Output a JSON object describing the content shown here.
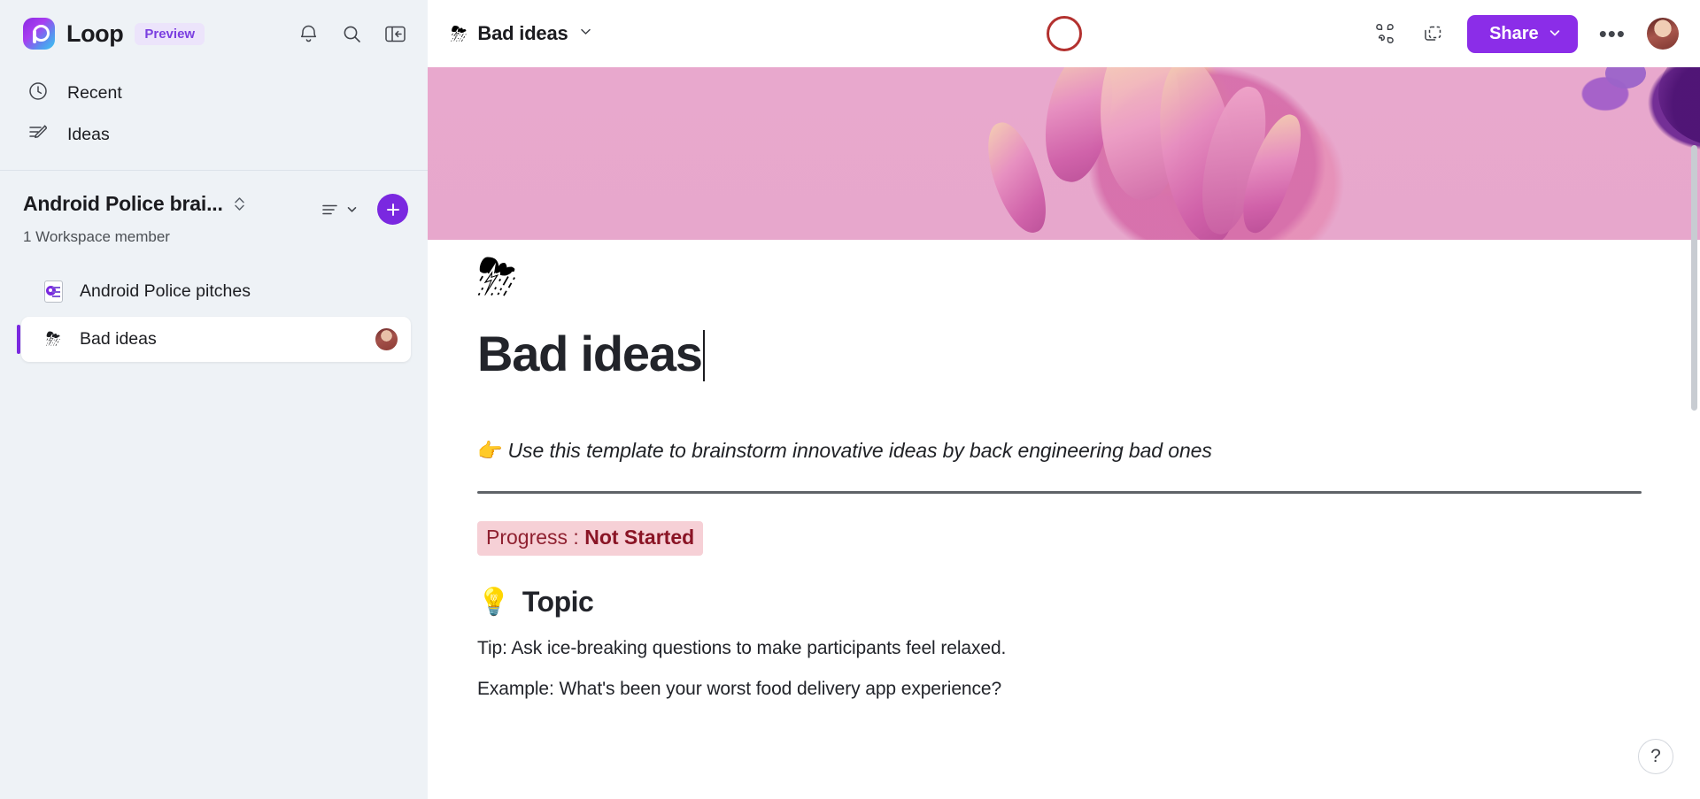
{
  "sidebar": {
    "brand": {
      "name": "Loop",
      "badge": "Preview",
      "logo_icon": "loop-logo"
    },
    "top_icons": [
      {
        "name": "notifications-icon",
        "label": "Notifications"
      },
      {
        "name": "search-icon",
        "label": "Search"
      },
      {
        "name": "collapse-panel-icon",
        "label": "Collapse navigation"
      }
    ],
    "nav": [
      {
        "label": "Recent",
        "icon": "clock-icon"
      },
      {
        "label": "Ideas",
        "icon": "pencil-lines-icon"
      }
    ],
    "workspace": {
      "title": "Android Police brai...",
      "members": "1 Workspace member",
      "switch_icon": "chevron-up-down-icon",
      "sort_icon": "sort-list-icon",
      "add_label": "+"
    },
    "pages": [
      {
        "label": "Android Police pitches",
        "icon": "loop-page-icon",
        "selected": false,
        "avatar": false
      },
      {
        "label": "Bad ideas",
        "icon": "cloud-lightning-emoji",
        "emoji": "⛈",
        "selected": true,
        "avatar": true
      }
    ]
  },
  "topbar": {
    "doc_name": "Bad ideas",
    "doc_emoji": "⛈",
    "doc_chevron_icon": "chevron-down-icon",
    "apps_icon": "apps-grid-icon",
    "copy_link_icon": "copy-component-icon",
    "share_label": "Share",
    "share_chevron_icon": "chevron-down-icon",
    "more_label": "•••",
    "accent_color": "#8b2de8",
    "presence_ring_color": "#b3312f"
  },
  "document": {
    "emoji": "⛈",
    "title": "Bad ideas",
    "description_emoji": "👉",
    "description": "Use this template to brainstorm innovative ideas by back engineering bad ones",
    "progress_label": "Progress : ",
    "progress_value": "Not Started",
    "progress_bg": "#f6d0d6",
    "progress_fg": "#8a1425",
    "topic_emoji": "💡",
    "topic_heading": "Topic",
    "paragraphs": [
      "Tip: Ask ice-breaking questions to make participants feel relaxed.",
      "Example: What's been your worst food delivery app experience?"
    ]
  },
  "help": {
    "label": "?"
  }
}
